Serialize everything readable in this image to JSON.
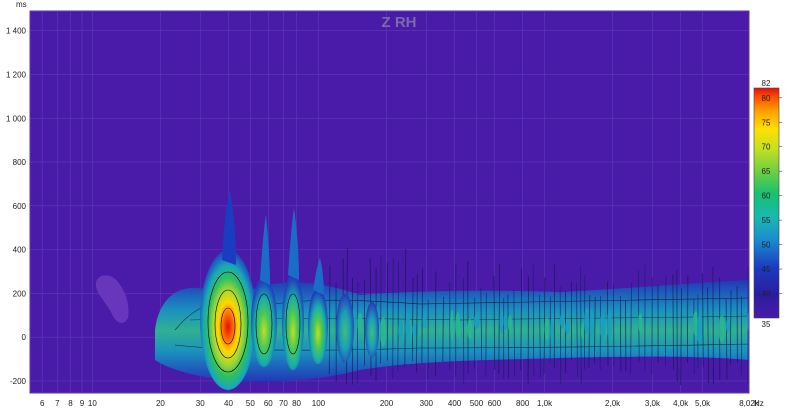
{
  "chart_data": {
    "type": "heatmap",
    "title": "Z RH",
    "y_unit": "ms",
    "x_unit": "Hz",
    "x_scale": "log",
    "xlim": [
      5.3,
      8020
    ],
    "ylim": [
      -255,
      1490
    ],
    "grid": true,
    "background_color": "#4a1aa8",
    "x_ticks": [
      {
        "value": 6,
        "label": "6"
      },
      {
        "value": 7,
        "label": "7"
      },
      {
        "value": 8,
        "label": "8"
      },
      {
        "value": 9,
        "label": "9"
      },
      {
        "value": 10,
        "label": "10"
      },
      {
        "value": 20,
        "label": "20"
      },
      {
        "value": 30,
        "label": "30"
      },
      {
        "value": 40,
        "label": "40"
      },
      {
        "value": 50,
        "label": "50"
      },
      {
        "value": 60,
        "label": "60"
      },
      {
        "value": 70,
        "label": "70"
      },
      {
        "value": 80,
        "label": "80"
      },
      {
        "value": 100,
        "label": "100"
      },
      {
        "value": 200,
        "label": "200"
      },
      {
        "value": 300,
        "label": "300"
      },
      {
        "value": 400,
        "label": "400"
      },
      {
        "value": 500,
        "label": "500"
      },
      {
        "value": 600,
        "label": "600"
      },
      {
        "value": 800,
        "label": "800"
      },
      {
        "value": 1000,
        "label": "1,0k"
      },
      {
        "value": 2000,
        "label": "2,0k"
      },
      {
        "value": 3000,
        "label": "3,0k"
      },
      {
        "value": 4000,
        "label": "4,0k"
      },
      {
        "value": 5000,
        "label": "5,0k"
      },
      {
        "value": 8020,
        "label": "8,02k"
      }
    ],
    "y_ticks": [
      {
        "value": 1400,
        "label": "1 400"
      },
      {
        "value": 1200,
        "label": "1 200"
      },
      {
        "value": 1000,
        "label": "1 000"
      },
      {
        "value": 800,
        "label": "800"
      },
      {
        "value": 600,
        "label": "600"
      },
      {
        "value": 400,
        "label": "400"
      },
      {
        "value": 200,
        "label": "200"
      },
      {
        "value": 0,
        "label": "0"
      },
      {
        "value": -200,
        "label": "-200"
      }
    ],
    "colorbar": {
      "min": 35,
      "max": 82,
      "ticks": [
        80,
        75,
        70,
        65,
        60,
        55,
        50,
        45,
        40
      ],
      "min_label": "35",
      "max_label": "82",
      "colors": [
        "#4a1aa8",
        "#2a1ca0",
        "#1a3cc0",
        "#1a8cd0",
        "#18b8b0",
        "#18c070",
        "#70d040",
        "#c8e020",
        "#ffe000",
        "#ffa000",
        "#ff5000",
        "#e01010"
      ]
    },
    "peaks": [
      {
        "freq": 45,
        "time_top": 630,
        "time_bottom": -260,
        "level": 82
      },
      {
        "freq": 60,
        "time_top": 420,
        "time_bottom": -250,
        "level": 67
      },
      {
        "freq": 80,
        "time_top": 560,
        "time_bottom": -255,
        "level": 68
      },
      {
        "freq": 100,
        "time_top": 300,
        "time_bottom": -250,
        "level": 64
      },
      {
        "freq": 130,
        "time_top": 330,
        "time_bottom": -245,
        "level": 60
      },
      {
        "freq": 12,
        "time_top": 250,
        "time_bottom": 10,
        "level": 36
      }
    ]
  }
}
